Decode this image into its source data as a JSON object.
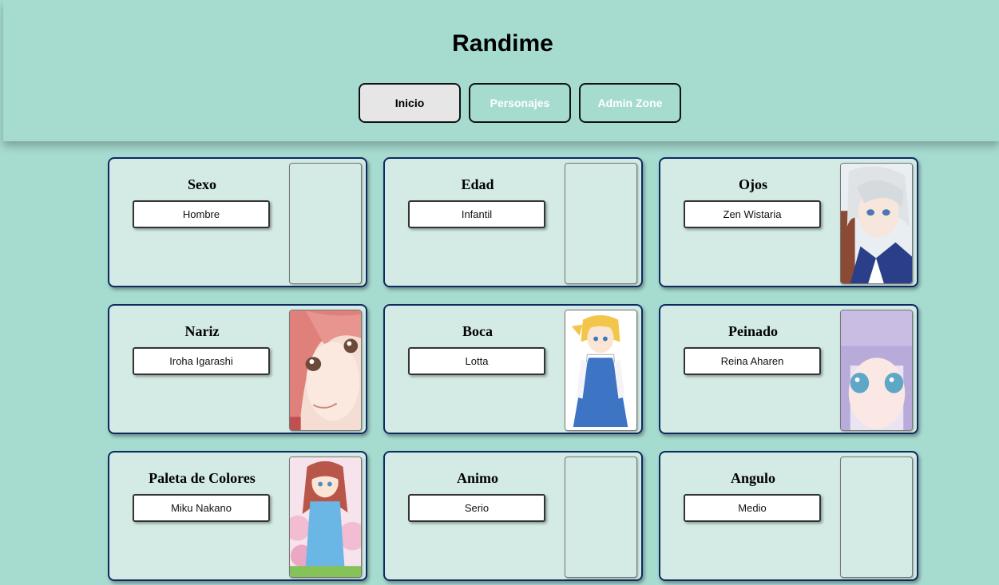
{
  "header": {
    "title": "Randime",
    "nav": [
      {
        "label": "Inicio",
        "active": true
      },
      {
        "label": "Personajes",
        "active": false
      },
      {
        "label": "Admin Zone",
        "active": false
      }
    ]
  },
  "cards": [
    {
      "title": "Sexo",
      "value": "Hombre",
      "image": "empty"
    },
    {
      "title": "Edad",
      "value": "Infantil",
      "image": "empty"
    },
    {
      "title": "Ojos",
      "value": "Zen Wistaria",
      "image": "white-hair-boy-portrait"
    },
    {
      "title": "Nariz",
      "value": "Iroha Igarashi",
      "image": "pink-hair-girl-closeup"
    },
    {
      "title": "Boca",
      "value": "Lotta",
      "image": "blonde-girl-blue-dress"
    },
    {
      "title": "Peinado",
      "value": "Reina Aharen",
      "image": "lavender-hair-girl-closeup"
    },
    {
      "title": "Paleta de Colores",
      "value": "Miku Nakano",
      "image": "redhead-girl-cherry-blossoms"
    },
    {
      "title": "Animo",
      "value": "Serio",
      "image": "empty"
    },
    {
      "title": "Angulo",
      "value": "Medio",
      "image": "empty"
    }
  ],
  "colors": {
    "background": "#a6dbd0",
    "card": "#d3ebe4",
    "card_border": "#0d2a63",
    "active_nav": "#e6e6e6"
  }
}
